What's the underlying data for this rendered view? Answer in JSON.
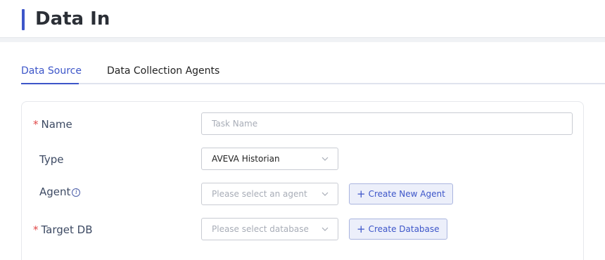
{
  "header": {
    "title": "Data In"
  },
  "tabs": [
    {
      "label": "Data Source",
      "active": true
    },
    {
      "label": "Data Collection Agents",
      "active": false
    }
  ],
  "form": {
    "name": {
      "label": "Name",
      "required": "*",
      "placeholder": "Task Name",
      "value": ""
    },
    "type": {
      "label": "Type",
      "value": "AVEVA Historian"
    },
    "agent": {
      "label": "Agent",
      "info_icon": "i",
      "placeholder": "Please select an agent",
      "button_label": "Create New Agent"
    },
    "target_db": {
      "label": "Target DB",
      "required": "*",
      "placeholder": "Please select database",
      "button_label": "Create Database"
    }
  },
  "icons": {
    "plus": "+",
    "chevron": "chevron-down-icon",
    "info": "info-icon"
  },
  "colors": {
    "accent": "#3d56c9",
    "required": "#e04848",
    "label": "#3d4a63"
  }
}
